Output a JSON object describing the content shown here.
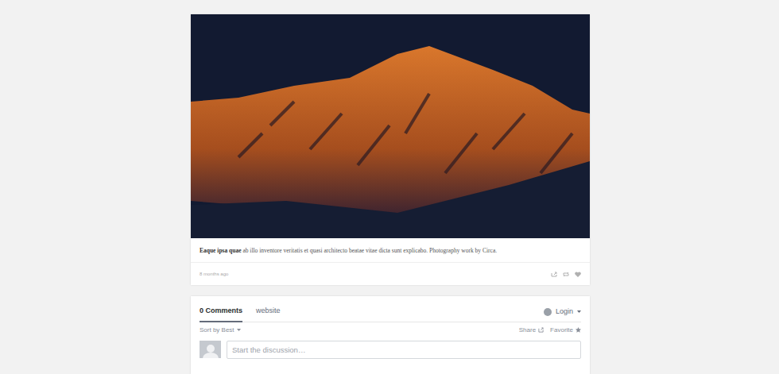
{
  "post": {
    "caption_bold": "Eaque ipsa quae",
    "caption": "ab illo inventore veritatis et quasi architecto beatae vitae dicta sunt explicabo. Photography work by Circa.",
    "time": "8 months ago"
  },
  "comments": {
    "tabs": [
      {
        "label": "0 Comments",
        "selected": true
      },
      {
        "label": "website",
        "selected": false
      }
    ],
    "login": "Login",
    "sort": "Sort by Best",
    "share": "Share",
    "favorite": "Favorite",
    "input": {
      "placeholder": "Start the discussion…"
    }
  }
}
